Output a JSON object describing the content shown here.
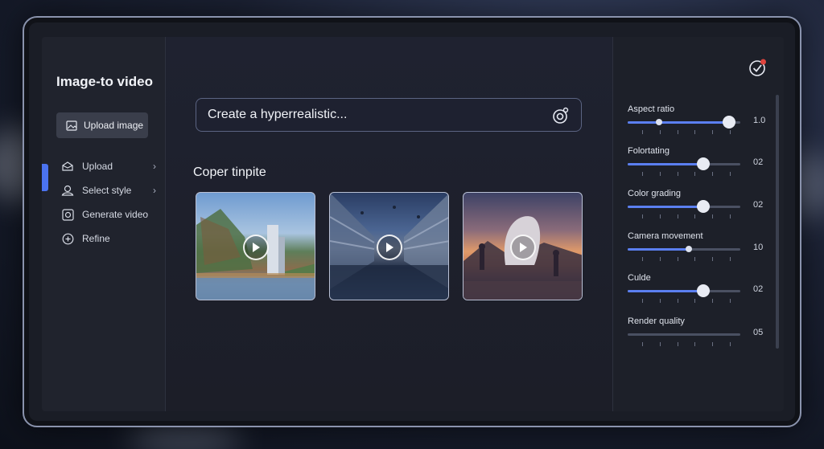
{
  "sidebar": {
    "title": "Image-to video",
    "upload_button": "Upload image",
    "items": [
      {
        "label": "Upload",
        "icon": "upload-icon",
        "chevron": true
      },
      {
        "label": "Select style",
        "icon": "user-style-icon",
        "chevron": true
      },
      {
        "label": "Generate video",
        "icon": "camera-icon",
        "chevron": false
      },
      {
        "label": "Refine",
        "icon": "plus-circle-icon",
        "chevron": false
      }
    ]
  },
  "main": {
    "prompt_text": "Create a hyperrealistic...",
    "section_title": "Coper tinpite",
    "thumbnails": [
      {
        "name": "coastal-city-scene"
      },
      {
        "name": "motion-blur-street-scene"
      },
      {
        "name": "sunset-sculpture-scene"
      }
    ]
  },
  "panel": {
    "sliders": [
      {
        "label": "Aspect ratio",
        "value": "1.0",
        "level": 0.9,
        "style": "dual"
      },
      {
        "label": "Folortating",
        "value": "02",
        "level": 0.67,
        "style": "knob"
      },
      {
        "label": "Color grading",
        "value": "02",
        "level": 0.67,
        "style": "knob"
      },
      {
        "label": "Camera movement",
        "value": "10",
        "level": 0.54,
        "style": "small"
      },
      {
        "label": "Culde",
        "value": "02",
        "level": 0.67,
        "style": "knob"
      },
      {
        "label": "Render quality",
        "value": "05",
        "level": 0,
        "style": "none"
      }
    ]
  },
  "colors": {
    "accent": "#4b73f0",
    "slider_fill": "#5b7ff0",
    "badge": "#e0443e"
  }
}
